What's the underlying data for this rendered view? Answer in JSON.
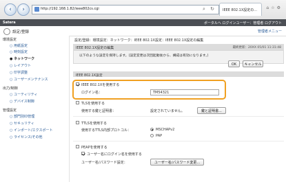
{
  "browser": {
    "url": "http://192.168.1.82/ieee802cs.cgi",
    "tab_label": "IEEE 802.1X設定の..."
  },
  "app": {
    "brand": "Satera",
    "header_links": "ポータルへ  ログインユーザー：管理者  ログアウト",
    "page_title": "設定/登録",
    "portal_link": "管理者メニュー"
  },
  "sidebar": {
    "sections": [
      {
        "label": "環境設定",
        "items": [
          "用紙設定",
          "時刻設定",
          "ネットワーク",
          "レイアウト",
          "印字調整",
          "ユーザーメンテナンス"
        ]
      },
      {
        "label": "出力/制御",
        "items": [
          "ユーティリティ",
          "デバイス制御"
        ]
      },
      {
        "label": "管理設定",
        "items": [
          "部門別ID管理",
          "セキュリティ",
          "インポート/エクスポート",
          "ライセンス/その他"
        ]
      }
    ],
    "active_item": "ネットワーク"
  },
  "main": {
    "breadcrumb": "設定/登録：環境設定：ネットワーク：IEEE 802.1X設定：IEEE 802.1X設定の編集",
    "title": "IEEE 802.1X設定の編集",
    "last_updated": "最終更新：20XX 05/01 11:31:48",
    "note": "以下のような設定を保持します。(設定変更は次回起動後から、構成は有効になります。)",
    "ok_label": "OK",
    "cancel_label": "キャンセル",
    "section_title": "IEEE 802.1X設定",
    "use_8021x_label": "IEEE 802.1Xを使用する",
    "login_name_label": "ログイン名：",
    "login_name_value": "TM54321",
    "tls_label": "TLSを使用する",
    "key_cert_label": "使用する鍵と証明書：",
    "key_cert_status": "設定されていません。",
    "key_cert_button": "鍵と証明書...",
    "ttls_label": "TTLSを使用する",
    "ttls_protocol_label": "使用するTTLS内部プロトコル：",
    "ttls_options": [
      "MSCHAPv2",
      "PAP"
    ],
    "peap_label": "PEAPを使用する",
    "same_user_label": "ユーザー名にログイン名を使用する",
    "user_password_label": "ユーザー名/パスワード設定：",
    "user_password_button": "ユーザー名/パスワード変更..."
  }
}
